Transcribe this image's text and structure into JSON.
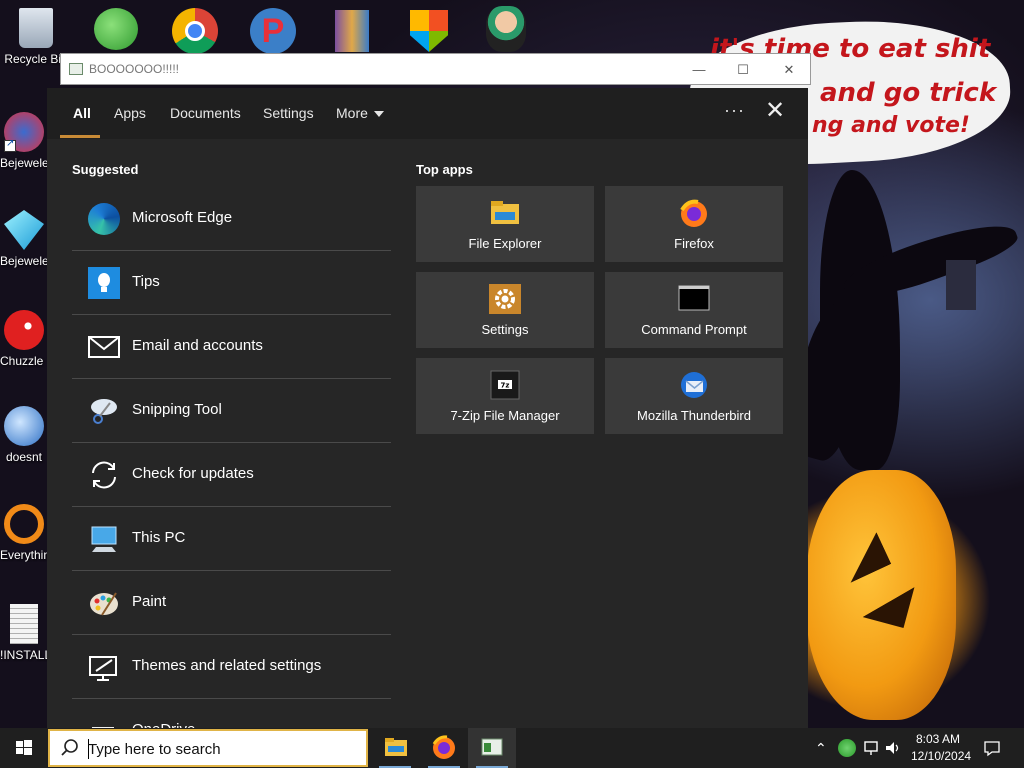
{
  "desktop": {
    "icons": [
      {
        "label": "Recycle Bin",
        "icon": "recycle-bin-icon"
      },
      {
        "label": "Bejeweled Deluxe",
        "icon": "bejeweled-icon"
      },
      {
        "label": "Bejeweled Deluxe",
        "icon": "bejeweled-diamond-icon"
      },
      {
        "label": "Chuzzle Deluxe",
        "icon": "chuzzle-icon"
      },
      {
        "label": "doesnt",
        "icon": "thunderbird-icon"
      },
      {
        "label": "Everything",
        "icon": "everything-search-icon"
      },
      {
        "label": "!INSTALL",
        "icon": "text-file-icon"
      }
    ],
    "top_icons": [
      "messenger-icon",
      "chrome-icon",
      "pidgin-p-icon",
      "winrar-icon",
      "windows-shield-icon",
      "game-character-icon"
    ],
    "wallpaper_text": {
      "line1": "it's time to eat shit",
      "line2": "and go trick",
      "line3": "ng and vote!"
    }
  },
  "background_window": {
    "title": "BOOOOOOO!!!!!",
    "minimize": "—",
    "maximize": "☐",
    "close": "✕"
  },
  "search_panel": {
    "tabs": [
      {
        "label": "All",
        "active": true
      },
      {
        "label": "Apps"
      },
      {
        "label": "Documents"
      },
      {
        "label": "Settings"
      },
      {
        "label": "More"
      }
    ],
    "more_options": "···",
    "close": "✕",
    "suggested_heading": "Suggested",
    "suggested": [
      {
        "label": "Microsoft Edge",
        "icon": "edge-icon"
      },
      {
        "label": "Tips",
        "icon": "tips-lightbulb-icon"
      },
      {
        "label": "Email and accounts",
        "icon": "mail-icon"
      },
      {
        "label": "Snipping Tool",
        "icon": "snipping-tool-icon"
      },
      {
        "label": "Check for updates",
        "icon": "sync-icon"
      },
      {
        "label": "This PC",
        "icon": "computer-icon"
      },
      {
        "label": "Paint",
        "icon": "paint-palette-icon"
      },
      {
        "label": "Themes and related settings",
        "icon": "themes-icon"
      },
      {
        "label": "OneDrive",
        "icon": "onedrive-icon"
      }
    ],
    "top_apps_heading": "Top apps",
    "top_apps": [
      {
        "label": "File Explorer",
        "icon": "folder-icon"
      },
      {
        "label": "Firefox",
        "icon": "firefox-icon"
      },
      {
        "label": "Settings",
        "icon": "gear-icon"
      },
      {
        "label": "Command Prompt",
        "icon": "command-prompt-icon"
      },
      {
        "label": "7-Zip File Manager",
        "icon": "7zip-icon"
      },
      {
        "label": "Mozilla Thunderbird",
        "icon": "thunderbird-icon"
      }
    ]
  },
  "taskbar": {
    "search_placeholder": "Type here to search",
    "apps": [
      "file-explorer-icon",
      "firefox-icon",
      "window-app-icon"
    ],
    "time": "8:03 AM",
    "date": "12/10/2024"
  },
  "colors": {
    "panel_bg": "#262626",
    "tile_bg": "#3a3a3a",
    "accent": "#c88a36",
    "taskbar_bg": "#1f1f1f"
  }
}
